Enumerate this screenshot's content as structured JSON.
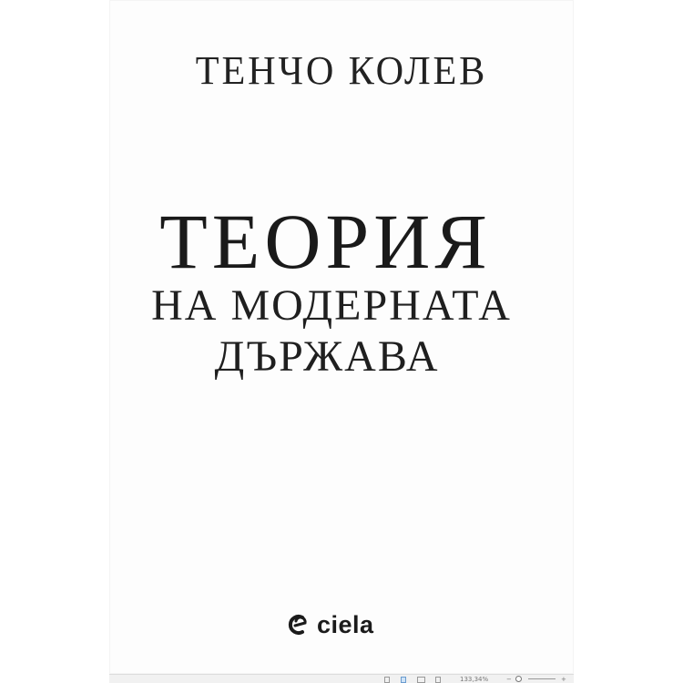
{
  "book": {
    "author": "ТЕНЧО КОЛЕВ",
    "title_line1": "ТЕОРИЯ",
    "title_line2": "НА МОДЕРНАТА",
    "title_line3": "ДЪРЖАВА",
    "publisher": "ciela"
  },
  "statusbar": {
    "zoom_label": "133,34%"
  },
  "icons": {
    "publisher_logo": "ciela-logo-icon",
    "view_single": "single-page-view-icon",
    "view_continuous": "continuous-page-view-icon",
    "view_two_page": "two-page-view-icon",
    "view_text": "text-view-icon",
    "zoom_out": "zoom-out-icon",
    "zoom_in": "zoom-in-icon"
  },
  "colors": {
    "ink": "#1a1a1a",
    "paper": "#fdfdfd",
    "statusbar": "#f1f1f1",
    "active_view": "#cfe3f7"
  }
}
